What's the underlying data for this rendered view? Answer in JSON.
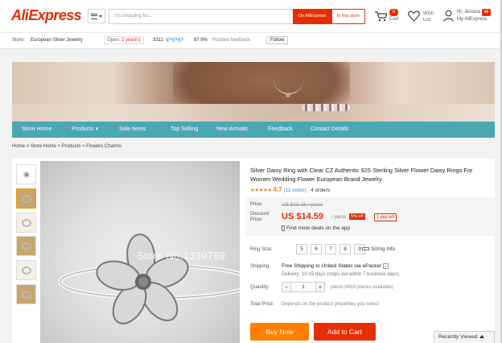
{
  "header": {
    "logo": "AliExpress",
    "search_placeholder": "I'm shopping for...",
    "btn_all": "On AliExpress",
    "btn_store": "In this store",
    "cart_count": "0",
    "cart_label": "Cart",
    "wish_label": "Wish List",
    "user_greeting": "Hi, Jessica",
    "user_badge": "All",
    "user_link": "My AliExpress"
  },
  "store_bar": {
    "store_label": "Store:",
    "store_name": "European Silver Jewelry",
    "open_label": "Open:",
    "open_years": "2 year(s)",
    "score": "3311",
    "diamonds": "💎💎💎",
    "positive_pct": "97.6%",
    "positive_label": "Positive feedback",
    "follow": "Follow"
  },
  "nav": {
    "items": [
      "Store Home",
      "Products ▾",
      "Sale Items",
      "Top Selling",
      "New Arrivals",
      "Feedback",
      "Contact Details"
    ]
  },
  "breadcrumb": [
    "Home",
    "Store Home",
    "Products",
    "Flowers Charms"
  ],
  "product": {
    "title": "Silver Daisy Ring with Clear CZ Authentic 925 Sterling Silver Flower Daisy Rings For Women Wedding Flower European Brand Jewelry",
    "rating": "4.7",
    "votes": "(11 votes)",
    "orders": "4 orders",
    "watermark": "Store No.1339769",
    "price_label": "Price:",
    "original_price": "US $15.36 / piece",
    "discount_label": "Discount Price:",
    "discount_price": "US $14.59",
    "per_piece": "/ piece",
    "off_badge": "5% off",
    "day_left": "1 day left",
    "deals": "Find more deals on the app",
    "size_label": "Ring Size:",
    "sizes": [
      "5",
      "6",
      "7",
      "8",
      "9"
    ],
    "size_info": "Sizing Info",
    "shipping_label": "Shipping:",
    "shipping": "Free Shipping to United States via ePacket",
    "delivery": "Delivery: 10-15 days (ships out within 7 business days)",
    "quantity_label": "Quantity:",
    "quantity": "1",
    "pieces_available": "piece (4919 pieces available)",
    "total_label": "Total Price:",
    "total": "Depends on the product properties you select",
    "buy_now": "Buy Now",
    "add_to_cart": "Add to Cart"
  },
  "recently_viewed": "Recently Viewed",
  "colors": {
    "brand": "#e62e04",
    "nav": "#4aa7b3",
    "buy": "#ff7f00"
  }
}
